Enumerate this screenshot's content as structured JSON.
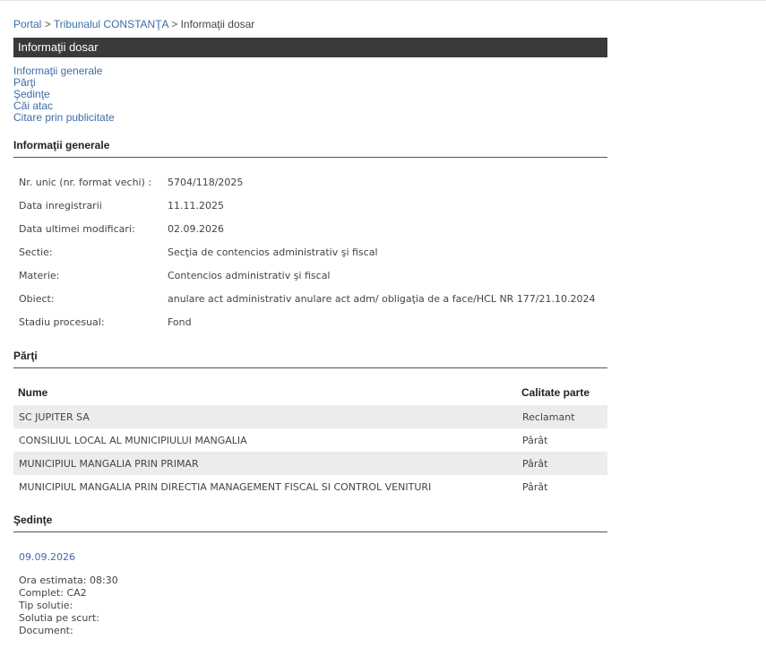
{
  "breadcrumb": {
    "items": [
      "Portal",
      "Tribunalul CONSTANŢA",
      "Informaţii dosar"
    ],
    "separator": ">"
  },
  "title_bar": {
    "text": "Informaţii dosar",
    "background": "#3a3a3a"
  },
  "anchors": [
    "Informaţii generale",
    "Părţi",
    "Şedinţe",
    "Căi atac",
    "Citare prin publicitate"
  ],
  "general": {
    "heading": "Informaţii generale",
    "rows": [
      {
        "label": "Nr. unic (nr. format vechi) :",
        "value": "5704/118/2025"
      },
      {
        "label": "Data inregistrarii",
        "value": "11.11.2025"
      },
      {
        "label": "Data ultimei modificari:",
        "value": "02.09.2026"
      },
      {
        "label": "Sectie:",
        "value": "Secţia de contencios administrativ şi fiscal"
      },
      {
        "label": "Materie:",
        "value": "Contencios administrativ şi fiscal"
      },
      {
        "label": "Obiect:",
        "value": "anulare act administrativ anulare act adm/ obligaţia de a face/HCL NR 177/21.10.2024"
      },
      {
        "label": "Stadiu procesual:",
        "value": "Fond"
      }
    ]
  },
  "parti": {
    "heading": "Părţi",
    "columns": {
      "name": "Nume",
      "role": "Calitate parte"
    },
    "rows": [
      {
        "name": "SC JUPITER SA",
        "role": "Reclamant"
      },
      {
        "name": "CONSILIUL LOCAL AL MUNICIPIULUI MANGALIA",
        "role": "Pârât"
      },
      {
        "name": "MUNICIPIUL MANGALIA PRIN PRIMAR",
        "role": "Pârât"
      },
      {
        "name": "MUNICIPIUL MANGALIA PRIN DIRECTIA MANAGEMENT FISCAL SI CONTROL VENITURI",
        "role": "Pârât"
      }
    ]
  },
  "sedinte": {
    "heading": "Şedinţe",
    "date": "09.09.2026",
    "details": [
      "Ora estimata: 08:30",
      "Complet: CA2",
      "Tip solutie:",
      "Solutia pe scurt:",
      "Document:"
    ]
  },
  "colors": {
    "link": "#3d6ea8",
    "row_alt": "#ececec"
  }
}
